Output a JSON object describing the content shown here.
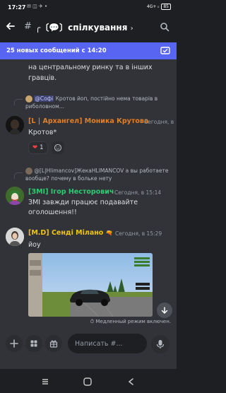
{
  "status_bar": {
    "time": "17:27",
    "notif_icons": "✉ ◫ ✈ •",
    "network": "4G+ ᵢₗ",
    "battery": "85"
  },
  "header": {
    "back_icon": "back-arrow-icon",
    "hash": "#",
    "channel_name": "╭〔💬〕спілкування",
    "chevron": "›"
  },
  "banner": {
    "text": "25 новых сообщений с 14:20",
    "mark_read_icon": "mark-read-icon"
  },
  "messages": [
    {
      "continuation": "на центральному ринку та в інших гравців."
    },
    {
      "reply_user": "@Софі",
      "reply_text": "Кротов йоп, постійно нема товарів в риболовном...",
      "author": "[L | Архангел] Моника Крутова",
      "author_color": "#e67e22",
      "timestamp": "Сегодня, в",
      "text": "Кротов*",
      "reaction_emoji": "❤",
      "reaction_count": "1"
    },
    {
      "reply_user": "@[L|Hlimancov]ЖекаНLIMANCOV",
      "reply_text": "а вы работаете вообще? почему в больке нету",
      "author": "[ЗМІ] Ігор Несторович",
      "author_color": "#2ecc71",
      "timestamp": "Сегодня, в 15:14",
      "text": "ЗМІ завжди працює подавайте оголошення!!"
    },
    {
      "author": "[M.D] Сенді Мілано",
      "author_color": "#f1c40f",
      "author_badge": "🔫",
      "timestamp": "Сегодня, в 15:29",
      "text": "йоу",
      "image_alt": "game-screenshot"
    }
  ],
  "slow_mode": "Медленный режим включен.",
  "input": {
    "placeholder": "Написать #..."
  },
  "colors": {
    "accent": "#5865f2",
    "background": "#313338",
    "header": "#1e1f22"
  }
}
